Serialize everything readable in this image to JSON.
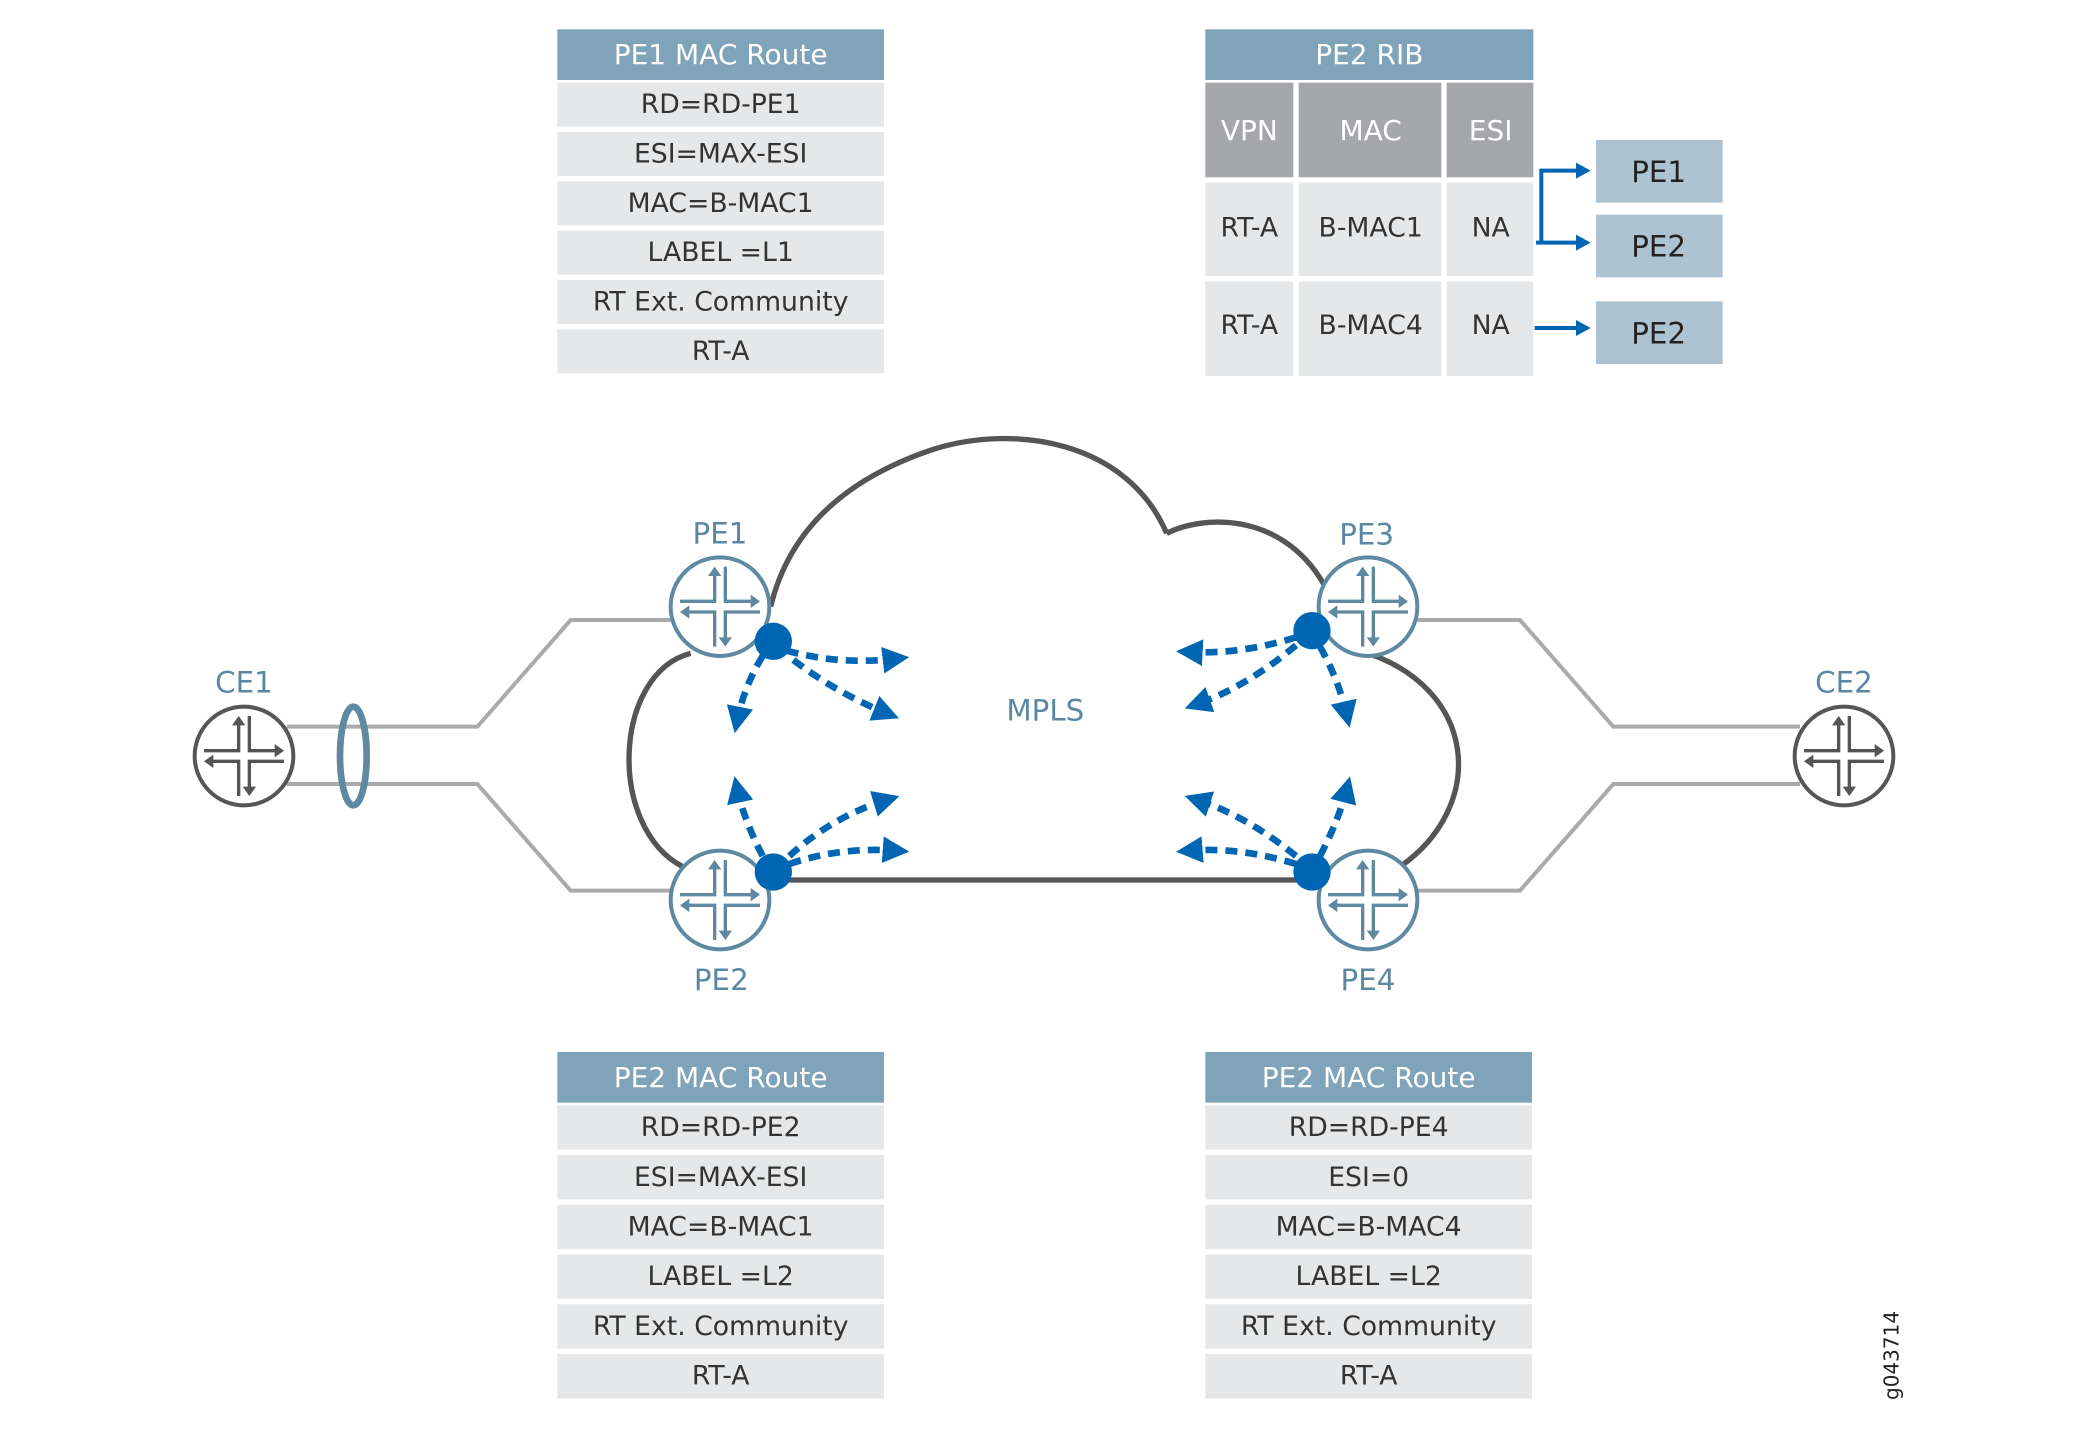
{
  "tables": [
    {
      "title": "PE1 MAC Route",
      "rows": [
        "RD=RD-PE1",
        "ESI=MAX-ESI",
        "MAC=B-MAC1",
        "LABEL =L1",
        "RT Ext. Community",
        "RT-A"
      ]
    },
    {
      "title": "PE2 MAC Route",
      "rows": [
        "RD=RD-PE2",
        "ESI=MAX-ESI",
        "MAC=B-MAC1",
        "LABEL =L2",
        "RT Ext. Community",
        "RT-A"
      ]
    },
    {
      "title": "PE2 MAC Route",
      "rows": [
        "RD=RD-PE4",
        "ESI=0",
        "MAC=B-MAC4",
        "LABEL =L2",
        "RT Ext. Community",
        "RT-A"
      ]
    }
  ],
  "rib": {
    "title": "PE2 RIB",
    "columns": [
      "VPN",
      "MAC",
      "ESI"
    ],
    "rows": [
      [
        "RT-A",
        "B-MAC1",
        "NA"
      ],
      [
        "RT-A",
        "B-MAC4",
        "NA"
      ]
    ],
    "next_hops": [
      "PE1",
      "PE2",
      "PE2"
    ]
  },
  "nodes": {
    "ce1": "CE1",
    "ce2": "CE2",
    "pe1": "PE1",
    "pe2": "PE2",
    "pe3": "PE3",
    "pe4": "PE4"
  },
  "cloud_label": "MPLS",
  "figure_id": "g043714",
  "colors": {
    "header": "#7fa3b9",
    "cell": "#e6e7e8",
    "column_header": "#a6a7aa",
    "next_hop_box": "#adc3d1",
    "accent_blue": "#0066b3",
    "pe_router": "#5f88a1",
    "ce_router": "#555555"
  }
}
